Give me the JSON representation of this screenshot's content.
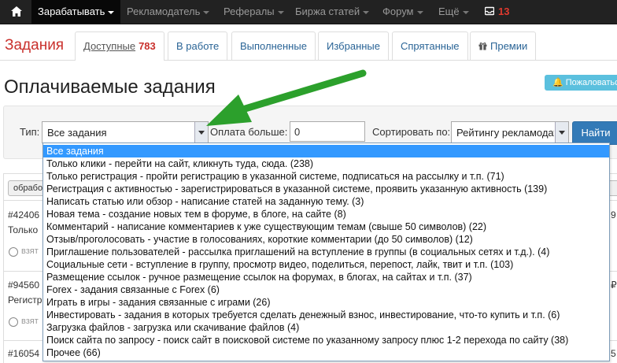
{
  "nav": {
    "items": [
      {
        "label": "Зарабатывать",
        "active": true
      },
      {
        "label": "Рекламодатель"
      },
      {
        "label": "Рефералы"
      },
      {
        "label": "Биржа статей"
      },
      {
        "label": "Форум"
      },
      {
        "label": "Ещё"
      }
    ],
    "mail_count": "13"
  },
  "tabs": {
    "brand": "Задания",
    "items": [
      {
        "label": "Доступные",
        "badge": "783",
        "active": true
      },
      {
        "label": "В работе"
      },
      {
        "label": "Выполненные"
      },
      {
        "label": "Избранные"
      },
      {
        "label": "Спрятанные"
      },
      {
        "label": "Премии"
      }
    ]
  },
  "page": {
    "title": "Оплачиваемые задания",
    "complain_label": "Пожаловаться"
  },
  "filter": {
    "type_label": "Тип:",
    "type_value": "Все задания",
    "pay_label": "Оплата больше:",
    "pay_value": "0",
    "sort_label": "Сортировать по:",
    "sort_value": "Рейтингу рекламодателя",
    "find_label": "Найти"
  },
  "background": {
    "button": "обработ",
    "rows": [
      {
        "id": "#42406",
        "text": "Только",
        "take": "взят",
        "right": "9"
      },
      {
        "id": "#94560",
        "text": "Регистр",
        "take": "взят",
        "right": "₽"
      },
      {
        "id": "#16054",
        "text": "",
        "take": "",
        "right": "5"
      }
    ]
  },
  "dropdown": {
    "options": [
      "Все задания",
      "Только клики - перейти на сайт, кликнуть туда, сюда. (238)",
      "Только регистрация - пройти регистрацию в указанной системе, подписаться на рассылку и т.п. (71)",
      "Регистрация с активностью - зарегистрироваться в указанной системе, проявить указанную активность (139)",
      "Написать статью или обзор - написание статей на заданную тему. (3)",
      "Новая тема - создание новых тем в форуме, в блоге, на сайте (8)",
      "Комментарий - написание комментариев к уже существующим темам (свыше 50 символов) (22)",
      "Отзыв/проголосовать - участие в голосованиях, короткие комментарии (до 50 символов) (12)",
      "Приглашение пользователей - рассылка приглашений на вступление в группы (в социальных сетях и т.д.). (4)",
      "Социальные сети - вступление в группу, просмотр видео, поделиться, перепост, лайк, твит и т.п. (103)",
      "Размещение ссылок - ручное размещение ссылок на форумах, в блогах, на сайтах и т.п. (37)",
      "Forex - задания связанные с Forex (6)",
      "Играть в игры - задания связанные с играми (26)",
      "Инвестировать - задания в которых требуется сделать денежный взнос, инвестирование, что-то купить и т.п. (6)",
      "Загрузка файлов - загрузка или скачивание файлов (4)",
      "Поиск сайта по запросу - поиск сайт в поисковой системе по указанному запросу плюс 1-2 перехода по сайту (38)",
      "Прочее (66)"
    ],
    "selected_index": 0
  },
  "colors": {
    "navbar": "#222222",
    "brand_red": "#c9302c",
    "link_blue": "#2a6496",
    "primary_btn": "#337ab7",
    "info_btn": "#5bc0de",
    "select_highlight": "#3399ff",
    "annotation_arrow": "#2ca02c"
  }
}
